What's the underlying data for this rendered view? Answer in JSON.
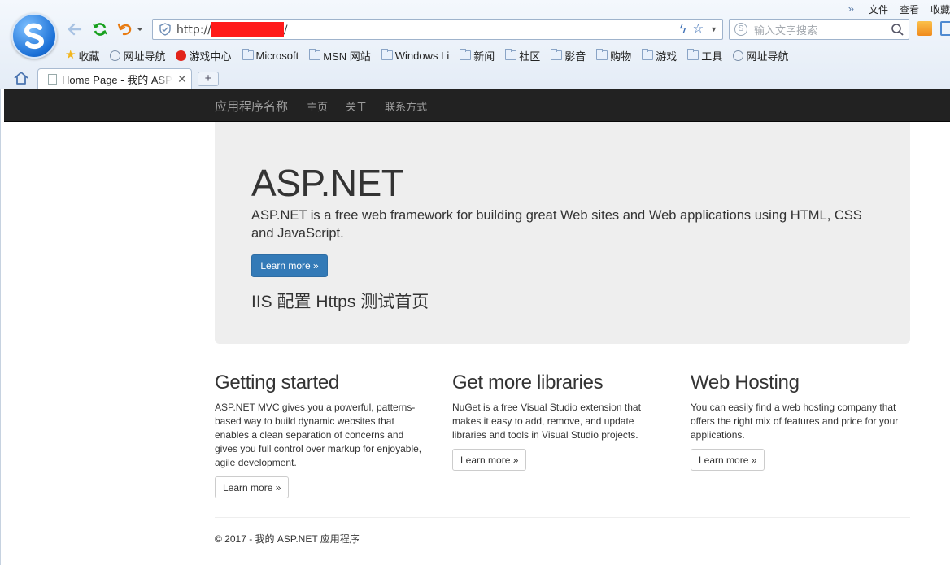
{
  "browser": {
    "menu": [
      "文件",
      "查看",
      "收藏"
    ],
    "address": {
      "prefix": "http://",
      "suffix": "/"
    },
    "search": {
      "placeholder": "输入文字搜索"
    },
    "bookmarks": [
      {
        "label": "收藏",
        "icon": "star-icon"
      },
      {
        "label": "网址导航",
        "icon": "globe-icon"
      },
      {
        "label": "游戏中心",
        "icon": "game-center-icon"
      },
      {
        "label": "Microsoft",
        "icon": "folder-icon"
      },
      {
        "label": "MSN 网站",
        "icon": "folder-icon"
      },
      {
        "label": "Windows Li",
        "icon": "folder-icon"
      },
      {
        "label": "新闻",
        "icon": "folder-icon"
      },
      {
        "label": "社区",
        "icon": "folder-icon"
      },
      {
        "label": "影音",
        "icon": "folder-icon"
      },
      {
        "label": "购物",
        "icon": "folder-icon"
      },
      {
        "label": "游戏",
        "icon": "folder-icon"
      },
      {
        "label": "工具",
        "icon": "folder-icon"
      },
      {
        "label": "网址导航",
        "icon": "globe-icon"
      }
    ],
    "tab": {
      "title": "Home Page - 我的 ASP.NET 应用程序"
    },
    "colors": {
      "chrome_bg": "#e4ecf6",
      "redaction": "#ff1a1a"
    }
  },
  "navbar": {
    "brand": "应用程序名称",
    "links": [
      "主页",
      "关于",
      "联系方式"
    ]
  },
  "jumbotron": {
    "title": "ASP.NET",
    "lead": "ASP.NET is a free web framework for building great Web sites and Web applications using HTML, CSS and JavaScript.",
    "button": "Learn more »",
    "subtitle": "IIS 配置 Https 测试首页"
  },
  "columns": [
    {
      "title": "Getting started",
      "text": "ASP.NET MVC gives you a powerful, patterns-based way to build dynamic websites that enables a clean separation of concerns and gives you full control over markup for enjoyable, agile development.",
      "button": "Learn more »"
    },
    {
      "title": "Get more libraries",
      "text": "NuGet is a free Visual Studio extension that makes it easy to add, remove, and update libraries and tools in Visual Studio projects.",
      "button": "Learn more »"
    },
    {
      "title": "Web Hosting",
      "text": "You can easily find a web hosting company that offers the right mix of features and price for your applications.",
      "button": "Learn more »"
    }
  ],
  "footer": {
    "text": "© 2017 - 我的 ASP.NET 应用程序"
  },
  "colors": {
    "navbar_bg": "#222222",
    "jumbotron_bg": "#eeeeee",
    "primary": "#337ab7"
  }
}
